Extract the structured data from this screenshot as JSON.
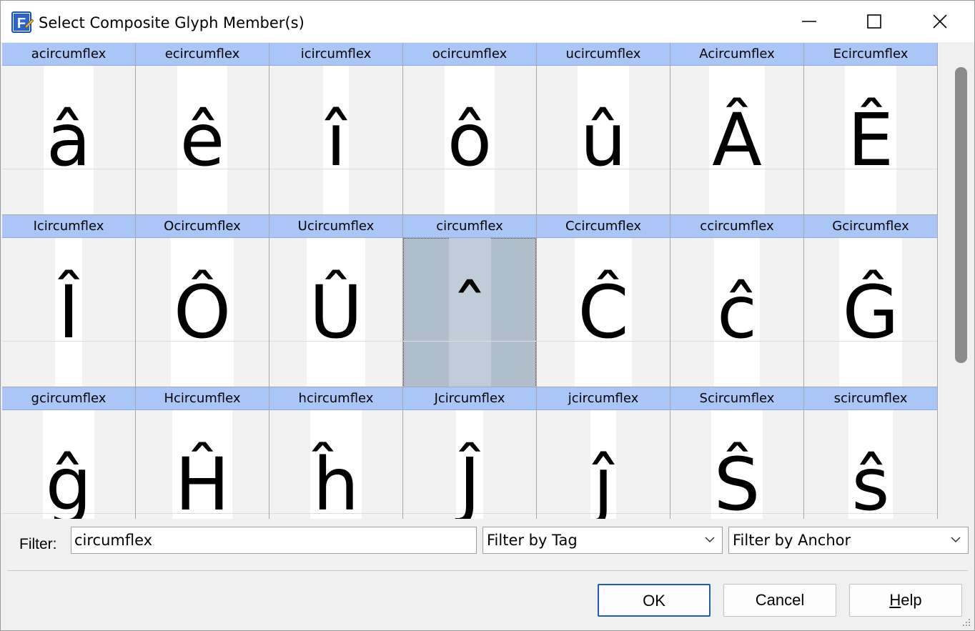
{
  "window": {
    "title": "Select Composite Glyph Member(s)",
    "app_icon": "font-editor-icon"
  },
  "title_buttons": {
    "minimize": "minimize-icon",
    "maximize": "maximize-icon",
    "close": "close-icon"
  },
  "glyphs": [
    {
      "name": "acircumflex",
      "char": "â"
    },
    {
      "name": "ecircumflex",
      "char": "ê"
    },
    {
      "name": "icircumflex",
      "char": "î"
    },
    {
      "name": "ocircumflex",
      "char": "ô"
    },
    {
      "name": "ucircumflex",
      "char": "û"
    },
    {
      "name": "Acircumflex",
      "char": "Â"
    },
    {
      "name": "Ecircumflex",
      "char": "Ê"
    },
    {
      "name": "Icircumflex",
      "char": "Î"
    },
    {
      "name": "Ocircumflex",
      "char": "Ô"
    },
    {
      "name": "Ucircumflex",
      "char": "Û"
    },
    {
      "name": "circumflex",
      "char": "ˆ",
      "selected": true
    },
    {
      "name": "Ccircumflex",
      "char": "Ĉ"
    },
    {
      "name": "ccircumflex",
      "char": "ĉ"
    },
    {
      "name": "Gcircumflex",
      "char": "Ĝ"
    },
    {
      "name": "gcircumflex",
      "char": "ĝ"
    },
    {
      "name": "Hcircumflex",
      "char": "Ĥ"
    },
    {
      "name": "hcircumflex",
      "char": "ĥ"
    },
    {
      "name": "Jcircumflex",
      "char": "Ĵ"
    },
    {
      "name": "jcircumflex",
      "char": "ĵ"
    },
    {
      "name": "Scircumflex",
      "char": "Ŝ"
    },
    {
      "name": "scircumflex",
      "char": "ŝ"
    }
  ],
  "filter": {
    "label": "Filter:",
    "value": "circumflex",
    "tag_select": "Filter by Tag",
    "anchor_select": "Filter by Anchor"
  },
  "buttons": {
    "ok": "OK",
    "cancel": "Cancel",
    "help_mnemonic": "H",
    "help_rest": "elp"
  },
  "colors": {
    "label_bg": "#a9c6f7",
    "selected_bg": "#b0becb",
    "default_button_border": "#1e5fb0"
  }
}
